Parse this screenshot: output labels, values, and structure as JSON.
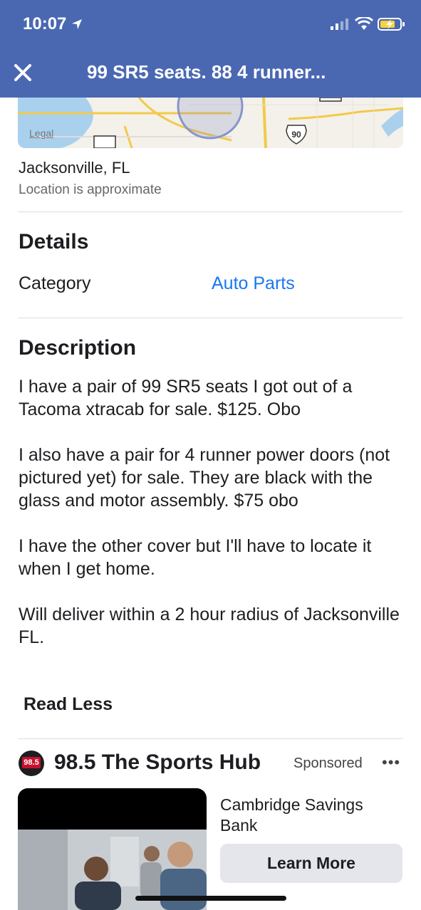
{
  "status_bar": {
    "time": "10:07"
  },
  "header": {
    "title": "99 SR5 seats. 88 4 runner..."
  },
  "map": {
    "legal_label": "Legal",
    "highway_label": "90"
  },
  "location": {
    "city": "Jacksonville, FL",
    "note": "Location is approximate"
  },
  "details": {
    "title": "Details",
    "category_label": "Category",
    "category_value": "Auto Parts"
  },
  "description": {
    "title": "Description",
    "paragraphs": [
      "I have a pair of 99 SR5 seats I got out of a Tacoma xtracab for sale. $125. Obo",
      "I also have a pair for 4 runner power doors (not pictured yet) for sale. They are black with the glass and motor assembly. $75 obo",
      "I have the other cover but I'll have to locate it when I get home.",
      "Will deliver within a 2 hour radius of Jacksonville FL."
    ],
    "toggle_label": "Read Less"
  },
  "ad": {
    "logo_text": "98.5",
    "page_name": "98.5 The Sports Hub",
    "sponsored": "Sponsored",
    "more_label": "•••",
    "advertiser": "Cambridge Savings Bank",
    "cta_label": "Learn More"
  },
  "colors": {
    "header_bg": "#4a68b2",
    "link": "#1877f2",
    "button_bg": "#e4e6eb"
  }
}
